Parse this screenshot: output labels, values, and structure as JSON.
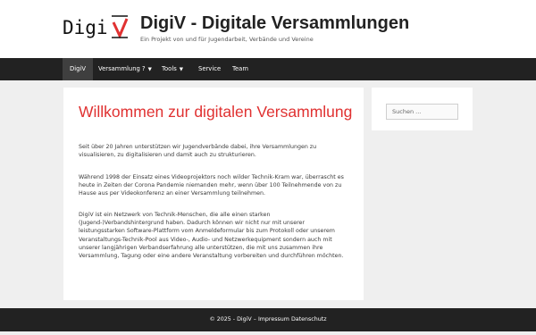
{
  "header": {
    "logo_text": "Digi",
    "logo_check_color": "#e03131",
    "site_title": "DigiV - Digitale Versammlungen",
    "site_description": "Ein Projekt von und für Jugendarbeit, Verbände und Vereine"
  },
  "nav": {
    "items": [
      {
        "label": "DigiV",
        "active": true
      },
      {
        "label": "Versammlung ?",
        "has_dropdown": true
      },
      {
        "label": "Tools",
        "has_dropdown": true
      },
      {
        "label": "Service"
      },
      {
        "label": "Team"
      }
    ]
  },
  "main": {
    "title": "Willkommen zur digitalen Versammlung",
    "paragraphs": [
      "Seit über 20 Jahren unterstützen wir Jugendverbände dabei, ihre Versammlungen zu visualisieren, zu digitalisieren und damit auch zu strukturieren.",
      "Während 1998 der Einsatz eines Videoprojektors noch wilder Technik-Kram war, überrascht es heute in Zeiten der Corona Pandemie niemanden mehr, wenn über 100 Teilnehmende von zu Hause aus per Videokonferenz an einer Versammlung teilnehmen.",
      "DigiV ist ein Netzwerk von Technik-Menschen, die alle einen starken (Jugend-)Verbandshintergrund haben. Dadurch können wir nicht nur mit unserer leistungsstarken Software-Plattform vom Anmeldeformular bis zum Protokoll oder unserem Veranstaltungs-Technik-Pool aus Video-, Audio- und Netzwerkequipment sondern auch mit unserer langjährigen Verbandserfahrung alle unterstützen, die mit uns zusammen ihre Versammlung, Tagung oder eine andere Veranstaltung vorbereiten und durchführen möchten."
    ]
  },
  "sidebar": {
    "search_placeholder": "Suchen ..."
  },
  "footer": {
    "copyright": "© 2025 - DigiV",
    "separator": "–",
    "links": [
      "Impressum",
      "Datenschutz"
    ]
  },
  "colors": {
    "accent": "#e03131",
    "nav_bg": "#222222",
    "nav_active": "#3f3f3f",
    "page_bg": "#efefef"
  }
}
